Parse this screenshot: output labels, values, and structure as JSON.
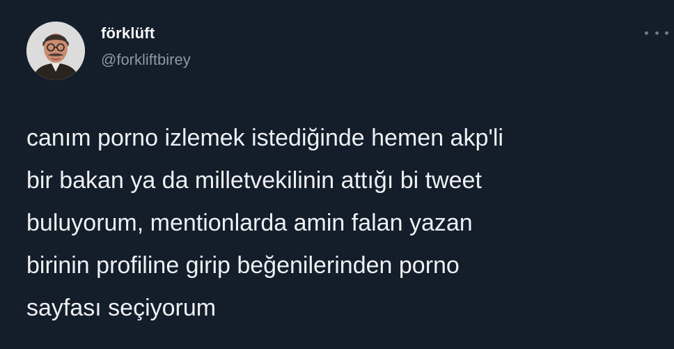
{
  "tweet": {
    "author": {
      "display_name": "förklüft",
      "handle": "@forkliftbirey",
      "avatar_icon": "profile-avatar"
    },
    "more_icon": "more-horizontal-icon",
    "text_lines": [
      "canım porno izlemek istediğinde hemen akp'li",
      "bir bakan ya da milletvekilinin attığı bi tweet",
      "buluyorum, mentionlarda amin falan yazan",
      "birinin profiline girip beğenilerinden porno",
      "sayfası seçiyorum"
    ]
  },
  "colors": {
    "background": "#141d2a",
    "text": "#eef1f4",
    "secondary_text": "#8b98a5"
  }
}
